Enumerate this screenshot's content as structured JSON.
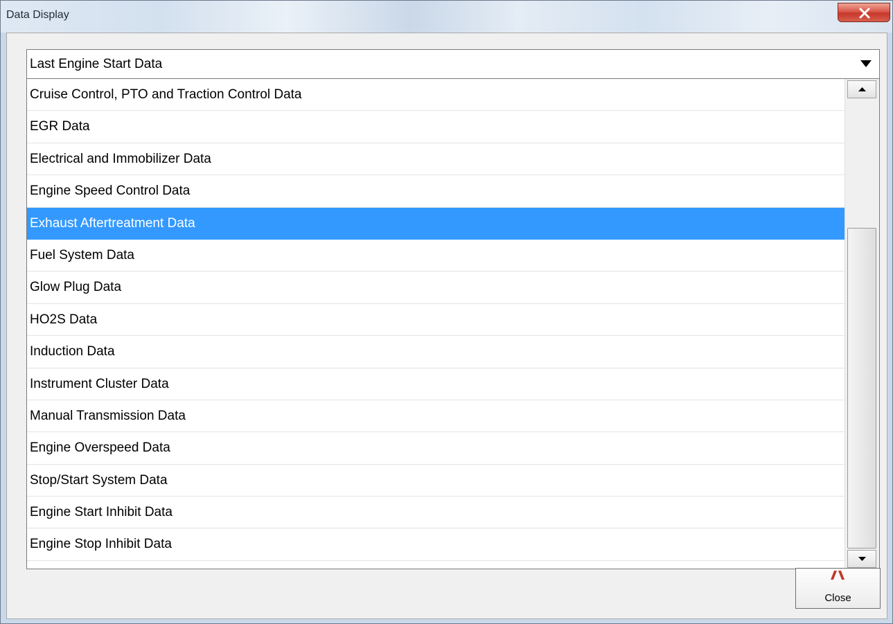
{
  "window": {
    "title": "Data Display",
    "close_icon": "close-x-icon"
  },
  "combo": {
    "value": "Last Engine Start Data",
    "dropdown_icon": "chevron-down-icon"
  },
  "list": {
    "items": [
      {
        "label": "Cruise Control, PTO and Traction Control Data",
        "selected": false
      },
      {
        "label": "EGR Data",
        "selected": false
      },
      {
        "label": "Electrical and Immobilizer Data",
        "selected": false
      },
      {
        "label": "Engine Speed Control Data",
        "selected": false
      },
      {
        "label": "Exhaust Aftertreatment Data",
        "selected": true
      },
      {
        "label": "Fuel System Data",
        "selected": false
      },
      {
        "label": "Glow Plug Data",
        "selected": false
      },
      {
        "label": "HO2S Data",
        "selected": false
      },
      {
        "label": "Induction Data",
        "selected": false
      },
      {
        "label": "Instrument Cluster Data",
        "selected": false
      },
      {
        "label": "Manual Transmission Data",
        "selected": false
      },
      {
        "label": "Engine Overspeed Data",
        "selected": false
      },
      {
        "label": "Stop/Start System Data",
        "selected": false
      },
      {
        "label": "Engine Start Inhibit Data",
        "selected": false
      },
      {
        "label": "Engine Stop Inhibit Data",
        "selected": false
      }
    ],
    "selection_color": "#3399ff"
  },
  "scrollbar": {
    "thumb_start_fraction": 0.285,
    "thumb_end_fraction": 1.0
  },
  "close_button": {
    "label": "Close",
    "icon": "close-icon"
  }
}
